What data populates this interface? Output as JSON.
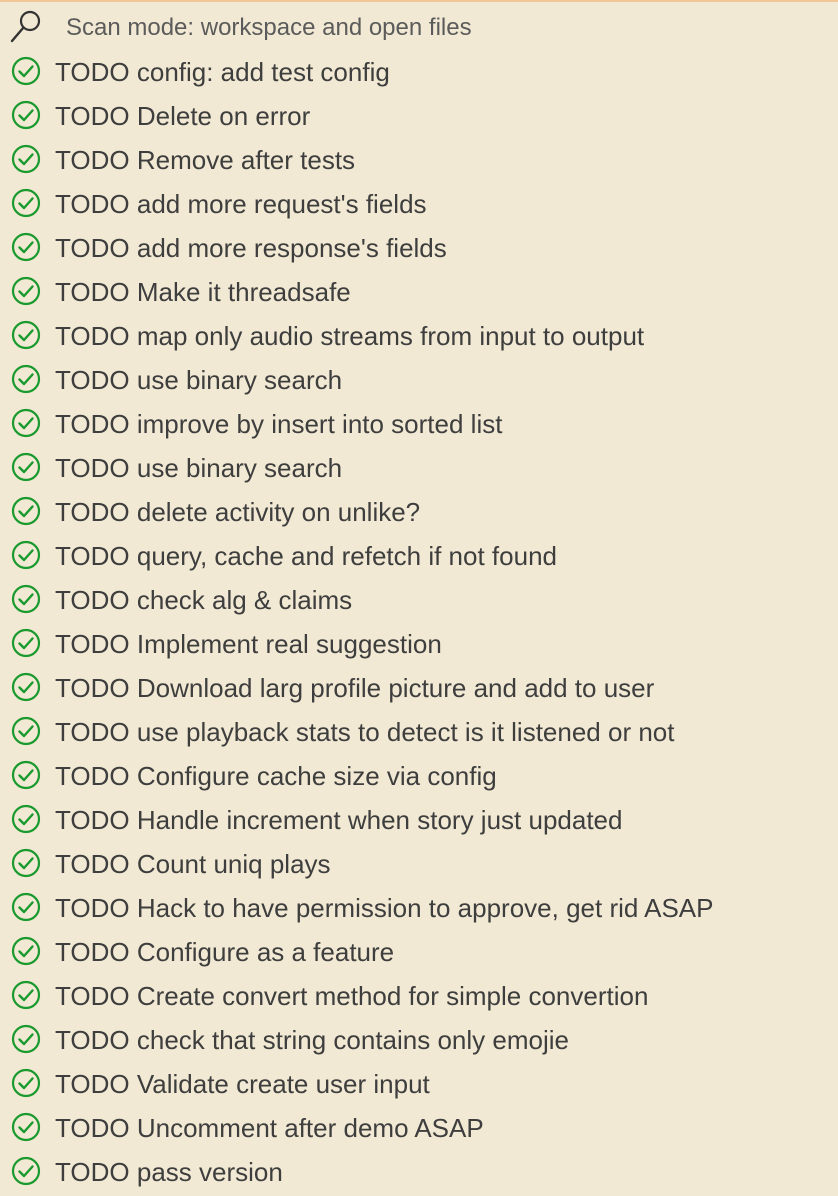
{
  "scan": {
    "icon": "search-icon",
    "label": "Scan mode: workspace and open files"
  },
  "colors": {
    "background": "#f1e9d3",
    "check": "#1a9a2e",
    "text": "#3e3e3e",
    "top_border": "#f0c896"
  },
  "todos": [
    {
      "icon": "check-circle-icon",
      "text": "TODO config: add test config"
    },
    {
      "icon": "check-circle-icon",
      "text": "TODO Delete on error"
    },
    {
      "icon": "check-circle-icon",
      "text": "TODO Remove after tests"
    },
    {
      "icon": "check-circle-icon",
      "text": "TODO add more request's fields"
    },
    {
      "icon": "check-circle-icon",
      "text": "TODO add more response's fields"
    },
    {
      "icon": "check-circle-icon",
      "text": "TODO Make it threadsafe"
    },
    {
      "icon": "check-circle-icon",
      "text": "TODO map only audio streams from input to output"
    },
    {
      "icon": "check-circle-icon",
      "text": "TODO use binary search"
    },
    {
      "icon": "check-circle-icon",
      "text": "TODO improve by insert into sorted list"
    },
    {
      "icon": "check-circle-icon",
      "text": "TODO use binary search"
    },
    {
      "icon": "check-circle-icon",
      "text": "TODO delete activity on unlike?"
    },
    {
      "icon": "check-circle-icon",
      "text": "TODO query, cache and refetch if not found"
    },
    {
      "icon": "check-circle-icon",
      "text": "TODO check alg & claims"
    },
    {
      "icon": "check-circle-icon",
      "text": "TODO Implement real suggestion"
    },
    {
      "icon": "check-circle-icon",
      "text": "TODO Download larg profile picture and add to user"
    },
    {
      "icon": "check-circle-icon",
      "text": "TODO use playback stats to detect is it listened or not"
    },
    {
      "icon": "check-circle-icon",
      "text": "TODO Configure cache size via config"
    },
    {
      "icon": "check-circle-icon",
      "text": "TODO Handle increment when story just updated"
    },
    {
      "icon": "check-circle-icon",
      "text": "TODO Count uniq plays"
    },
    {
      "icon": "check-circle-icon",
      "text": "TODO Hack to have permission to approve, get rid ASAP"
    },
    {
      "icon": "check-circle-icon",
      "text": "TODO Configure as a feature"
    },
    {
      "icon": "check-circle-icon",
      "text": "TODO Create convert method for simple convertion"
    },
    {
      "icon": "check-circle-icon",
      "text": "TODO check that string contains only emojie"
    },
    {
      "icon": "check-circle-icon",
      "text": "TODO Validate create user input"
    },
    {
      "icon": "check-circle-icon",
      "text": "TODO Uncomment after demo ASAP"
    },
    {
      "icon": "check-circle-icon",
      "text": "TODO pass version"
    }
  ]
}
